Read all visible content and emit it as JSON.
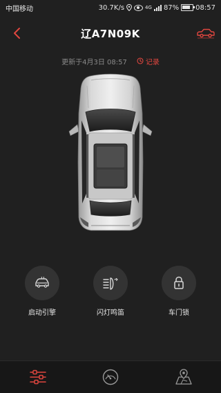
{
  "status_bar": {
    "carrier": "中国移动",
    "speed": "30.7K/s",
    "network": "4G",
    "battery": "87%",
    "battery_level": 0.87,
    "time": "08:57"
  },
  "header": {
    "title": "辽A7N09K"
  },
  "update": {
    "text": "更新于4月3日 08:57",
    "record_label": "记录"
  },
  "controls": [
    {
      "label": "启动引擎",
      "icon": "engine-start-icon"
    },
    {
      "label": "闪灯鸣笛",
      "icon": "headlight-horn-icon"
    },
    {
      "label": "车门锁",
      "icon": "lock-icon"
    }
  ],
  "nav": [
    {
      "icon": "sliders-icon",
      "active": true
    },
    {
      "icon": "speedometer-icon",
      "active": false
    },
    {
      "icon": "map-pin-icon",
      "active": false
    }
  ],
  "colors": {
    "background": "#202020",
    "accent": "#e0463f",
    "muted": "#8a8a8a"
  }
}
